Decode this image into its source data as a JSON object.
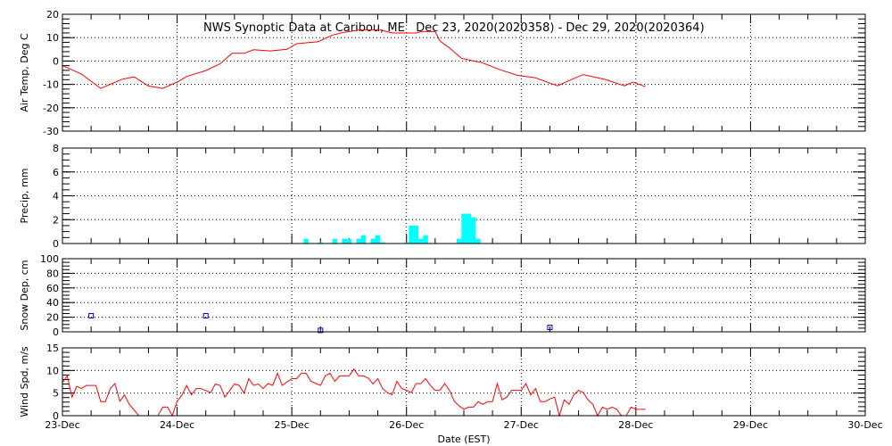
{
  "chart_data": [
    {
      "type": "line",
      "title": "NWS Synoptic Data at Caribou, ME   Dec 23, 2020(2020358) - Dec 29, 2020(2020364)",
      "ylabel": "Air Temp, Deg C",
      "ylim": [
        -30,
        20
      ],
      "yticks": [
        "20",
        "10",
        "0",
        "-10",
        "-20",
        "-30"
      ],
      "color": "#ff0000",
      "x_hours": [
        0,
        4,
        8,
        12.5,
        15,
        18,
        21,
        24.3,
        26,
        30,
        33,
        35.5,
        38,
        40,
        43.5,
        47,
        49,
        53.5,
        56.5,
        59,
        62,
        66.5,
        69,
        74,
        75,
        78,
        79,
        81,
        83.5,
        86,
        87.7,
        91.4,
        95.2,
        99,
        102.6,
        103.6,
        106.4,
        109,
        113.8,
        117.6,
        119.4,
        122
      ],
      "values": [
        -2,
        -5.6,
        -11.7,
        -7.8,
        -6.8,
        -10.7,
        -11.7,
        -8.7,
        -6.6,
        -4.1,
        -1.2,
        3.3,
        3.3,
        4.8,
        4.3,
        5,
        7.4,
        8.3,
        11.1,
        12.3,
        13.3,
        13.3,
        12,
        12,
        12.6,
        12.6,
        8.6,
        5.6,
        1.2,
        0,
        -0.6,
        -3.6,
        -6.1,
        -7.2,
        -9.9,
        -10.6,
        -8,
        -5.8,
        -8,
        -10.6,
        -9,
        -11
      ]
    },
    {
      "type": "bar",
      "ylabel": "Precip, mm",
      "ylim": [
        0,
        8
      ],
      "yticks": [
        "8",
        "6",
        "4",
        "2",
        "0"
      ],
      "color": "#00ffff",
      "x_hours": [
        51,
        54,
        57,
        59,
        60,
        62,
        63,
        65,
        66,
        67,
        72,
        73,
        74,
        75,
        76,
        83,
        84,
        85,
        86,
        87
      ],
      "values": [
        0.4,
        0.1,
        0.4,
        0.4,
        0.4,
        0.4,
        0.7,
        0.4,
        0.7,
        0.1,
        0.1,
        1.5,
        1.5,
        0.4,
        0.7,
        0.4,
        2.5,
        2.5,
        2.2,
        0.4
      ]
    },
    {
      "type": "scatter",
      "ylabel": "Snow Dep, cm",
      "ylim": [
        0,
        100
      ],
      "yticks": [
        "100",
        "80",
        "60",
        "40",
        "20",
        "0"
      ],
      "color": "#0000cc",
      "x_hours": [
        6,
        30,
        54,
        102
      ],
      "values": [
        22,
        22,
        2,
        6
      ]
    },
    {
      "type": "line",
      "ylabel": "Wind Spd, m/s",
      "xlabel": "Date (EST)",
      "ylim": [
        0,
        15
      ],
      "yticks": [
        "15",
        "10",
        "5",
        "0"
      ],
      "color": "#ff0000",
      "x_hours": [
        0,
        1,
        2,
        3,
        4,
        5,
        7,
        8,
        9,
        10,
        11,
        12,
        13,
        14,
        16,
        20,
        21,
        22,
        23,
        24,
        25,
        26,
        27,
        28,
        29,
        31,
        32,
        33,
        34,
        36,
        37,
        38,
        39,
        40,
        41,
        42,
        43,
        44,
        45,
        46,
        48,
        49,
        50,
        51,
        52,
        54,
        55,
        56,
        57,
        58,
        60,
        61,
        62,
        63,
        64,
        65,
        66,
        67,
        68,
        69,
        70,
        71,
        72,
        73,
        74,
        75,
        76,
        77,
        78,
        79,
        80,
        81,
        82,
        83,
        84,
        85,
        86,
        87,
        88,
        89,
        90,
        91,
        92,
        93,
        94,
        96,
        97,
        98,
        99,
        100,
        101,
        102,
        103,
        104,
        105,
        106,
        107,
        108,
        109,
        110,
        111,
        112,
        113,
        114,
        115,
        116,
        117,
        118,
        119,
        120,
        122
      ],
      "values": [
        7.3,
        8.8,
        4.1,
        6.5,
        6,
        6.7,
        6.7,
        3.1,
        3.1,
        6,
        7.1,
        3.2,
        4.6,
        2.5,
        0,
        0,
        1.9,
        1.9,
        0,
        3.2,
        4.5,
        6.7,
        4.6,
        6,
        6,
        5.1,
        7,
        6.7,
        4.1,
        7,
        6.7,
        5,
        8.2,
        6.7,
        7,
        6,
        7.1,
        6.7,
        9.4,
        6.7,
        8.2,
        8.2,
        9.4,
        9.4,
        7.6,
        6.7,
        8.8,
        9.4,
        7.6,
        8.8,
        8.8,
        10.3,
        8.8,
        8.8,
        8.3,
        7,
        8.2,
        6,
        5.1,
        4.6,
        7.6,
        6,
        5.6,
        5.1,
        7.1,
        7.1,
        8.2,
        6.7,
        5.6,
        5.6,
        7.1,
        5.6,
        3.2,
        2.2,
        1.4,
        1.9,
        1.9,
        3.1,
        2.5,
        3.1,
        3.1,
        7.1,
        3.5,
        4.1,
        5.6,
        5.6,
        7.1,
        4.6,
        6,
        3.1,
        3.1,
        3.7,
        4.1,
        0,
        3.5,
        2.5,
        4.6,
        5.6,
        5.1,
        3.5,
        2.5,
        0,
        1.9,
        1.4,
        1.9,
        1.4,
        0,
        0,
        1.9,
        1.4,
        1.4
      ]
    }
  ],
  "x_axis": {
    "tick_labels": [
      "23-Dec",
      "24-Dec",
      "25-Dec",
      "26-Dec",
      "27-Dec",
      "28-Dec",
      "29-Dec",
      "30-Dec"
    ],
    "xlabel": "Date (EST)",
    "days": 7
  }
}
